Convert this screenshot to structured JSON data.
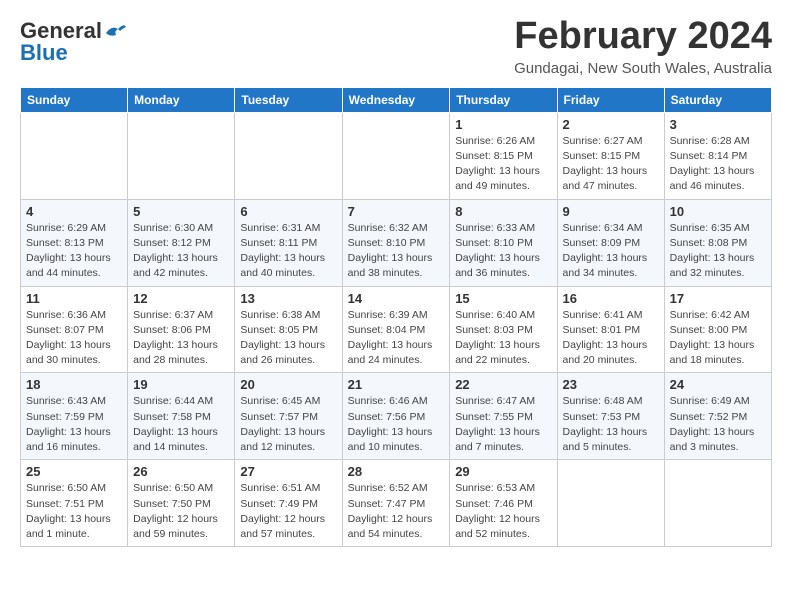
{
  "header": {
    "logo_general": "General",
    "logo_blue": "Blue",
    "month": "February 2024",
    "location": "Gundagai, New South Wales, Australia"
  },
  "weekdays": [
    "Sunday",
    "Monday",
    "Tuesday",
    "Wednesday",
    "Thursday",
    "Friday",
    "Saturday"
  ],
  "weeks": [
    [
      {
        "day": "",
        "info": ""
      },
      {
        "day": "",
        "info": ""
      },
      {
        "day": "",
        "info": ""
      },
      {
        "day": "",
        "info": ""
      },
      {
        "day": "1",
        "info": "Sunrise: 6:26 AM\nSunset: 8:15 PM\nDaylight: 13 hours\nand 49 minutes."
      },
      {
        "day": "2",
        "info": "Sunrise: 6:27 AM\nSunset: 8:15 PM\nDaylight: 13 hours\nand 47 minutes."
      },
      {
        "day": "3",
        "info": "Sunrise: 6:28 AM\nSunset: 8:14 PM\nDaylight: 13 hours\nand 46 minutes."
      }
    ],
    [
      {
        "day": "4",
        "info": "Sunrise: 6:29 AM\nSunset: 8:13 PM\nDaylight: 13 hours\nand 44 minutes."
      },
      {
        "day": "5",
        "info": "Sunrise: 6:30 AM\nSunset: 8:12 PM\nDaylight: 13 hours\nand 42 minutes."
      },
      {
        "day": "6",
        "info": "Sunrise: 6:31 AM\nSunset: 8:11 PM\nDaylight: 13 hours\nand 40 minutes."
      },
      {
        "day": "7",
        "info": "Sunrise: 6:32 AM\nSunset: 8:10 PM\nDaylight: 13 hours\nand 38 minutes."
      },
      {
        "day": "8",
        "info": "Sunrise: 6:33 AM\nSunset: 8:10 PM\nDaylight: 13 hours\nand 36 minutes."
      },
      {
        "day": "9",
        "info": "Sunrise: 6:34 AM\nSunset: 8:09 PM\nDaylight: 13 hours\nand 34 minutes."
      },
      {
        "day": "10",
        "info": "Sunrise: 6:35 AM\nSunset: 8:08 PM\nDaylight: 13 hours\nand 32 minutes."
      }
    ],
    [
      {
        "day": "11",
        "info": "Sunrise: 6:36 AM\nSunset: 8:07 PM\nDaylight: 13 hours\nand 30 minutes."
      },
      {
        "day": "12",
        "info": "Sunrise: 6:37 AM\nSunset: 8:06 PM\nDaylight: 13 hours\nand 28 minutes."
      },
      {
        "day": "13",
        "info": "Sunrise: 6:38 AM\nSunset: 8:05 PM\nDaylight: 13 hours\nand 26 minutes."
      },
      {
        "day": "14",
        "info": "Sunrise: 6:39 AM\nSunset: 8:04 PM\nDaylight: 13 hours\nand 24 minutes."
      },
      {
        "day": "15",
        "info": "Sunrise: 6:40 AM\nSunset: 8:03 PM\nDaylight: 13 hours\nand 22 minutes."
      },
      {
        "day": "16",
        "info": "Sunrise: 6:41 AM\nSunset: 8:01 PM\nDaylight: 13 hours\nand 20 minutes."
      },
      {
        "day": "17",
        "info": "Sunrise: 6:42 AM\nSunset: 8:00 PM\nDaylight: 13 hours\nand 18 minutes."
      }
    ],
    [
      {
        "day": "18",
        "info": "Sunrise: 6:43 AM\nSunset: 7:59 PM\nDaylight: 13 hours\nand 16 minutes."
      },
      {
        "day": "19",
        "info": "Sunrise: 6:44 AM\nSunset: 7:58 PM\nDaylight: 13 hours\nand 14 minutes."
      },
      {
        "day": "20",
        "info": "Sunrise: 6:45 AM\nSunset: 7:57 PM\nDaylight: 13 hours\nand 12 minutes."
      },
      {
        "day": "21",
        "info": "Sunrise: 6:46 AM\nSunset: 7:56 PM\nDaylight: 13 hours\nand 10 minutes."
      },
      {
        "day": "22",
        "info": "Sunrise: 6:47 AM\nSunset: 7:55 PM\nDaylight: 13 hours\nand 7 minutes."
      },
      {
        "day": "23",
        "info": "Sunrise: 6:48 AM\nSunset: 7:53 PM\nDaylight: 13 hours\nand 5 minutes."
      },
      {
        "day": "24",
        "info": "Sunrise: 6:49 AM\nSunset: 7:52 PM\nDaylight: 13 hours\nand 3 minutes."
      }
    ],
    [
      {
        "day": "25",
        "info": "Sunrise: 6:50 AM\nSunset: 7:51 PM\nDaylight: 13 hours\nand 1 minute."
      },
      {
        "day": "26",
        "info": "Sunrise: 6:50 AM\nSunset: 7:50 PM\nDaylight: 12 hours\nand 59 minutes."
      },
      {
        "day": "27",
        "info": "Sunrise: 6:51 AM\nSunset: 7:49 PM\nDaylight: 12 hours\nand 57 minutes."
      },
      {
        "day": "28",
        "info": "Sunrise: 6:52 AM\nSunset: 7:47 PM\nDaylight: 12 hours\nand 54 minutes."
      },
      {
        "day": "29",
        "info": "Sunrise: 6:53 AM\nSunset: 7:46 PM\nDaylight: 12 hours\nand 52 minutes."
      },
      {
        "day": "",
        "info": ""
      },
      {
        "day": "",
        "info": ""
      }
    ]
  ]
}
